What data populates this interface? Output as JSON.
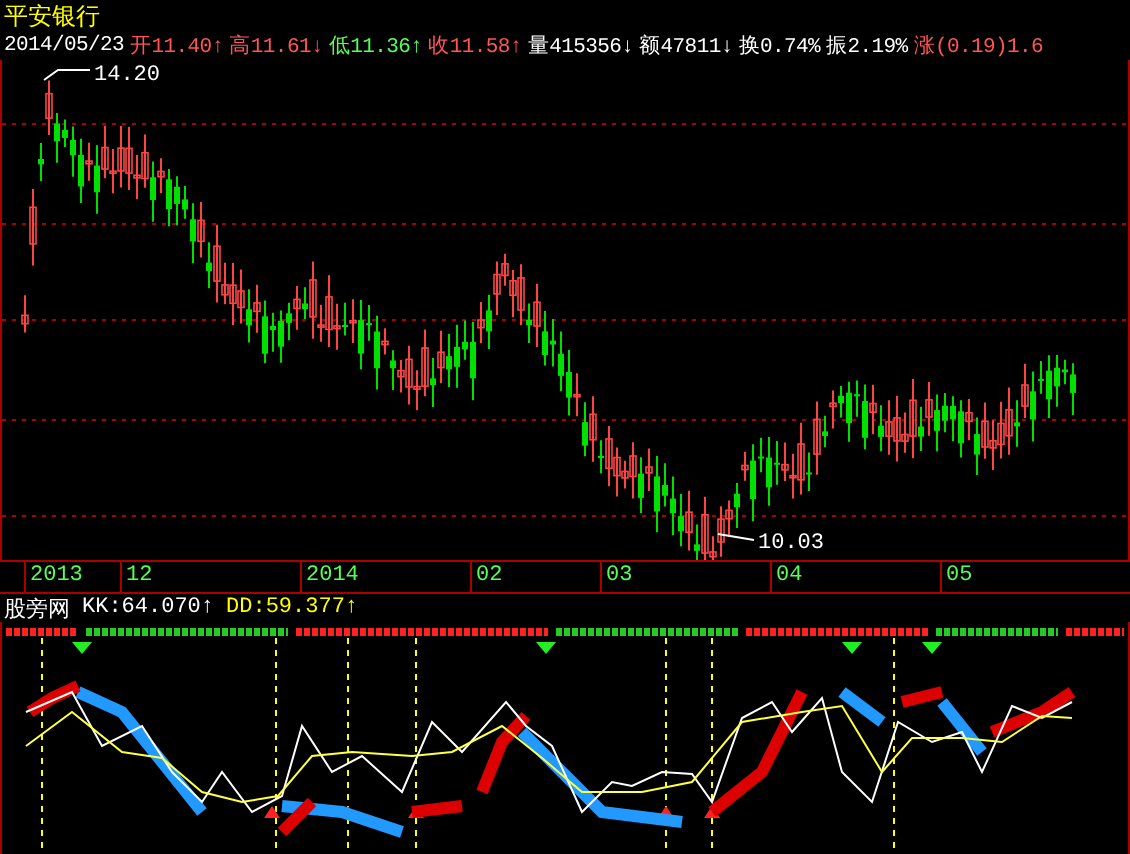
{
  "stock": {
    "name": "平安银行"
  },
  "quote": {
    "date": "2014/05/23",
    "items": [
      {
        "label": "开",
        "value": "11.40",
        "arrow": "↑",
        "color": "#ff5555"
      },
      {
        "label": "高",
        "value": "11.61",
        "arrow": "↓",
        "color": "#ff5555"
      },
      {
        "label": "低",
        "value": "11.36",
        "arrow": "↑",
        "color": "#55ff55"
      },
      {
        "label": "收",
        "value": "11.58",
        "arrow": "↑",
        "color": "#ff5555"
      },
      {
        "label": "量",
        "value": "415356",
        "arrow": "↓",
        "color": "#ffffff"
      },
      {
        "label": "额",
        "value": "47811",
        "arrow": "↓",
        "color": "#ffffff"
      },
      {
        "label": "换",
        "value": "0.74%",
        "color": "#ffffff"
      },
      {
        "label": "振",
        "value": "2.19%",
        "color": "#ffffff"
      },
      {
        "label": "涨",
        "value": "(0.19)1.6",
        "color": "#ff5555"
      }
    ]
  },
  "price_chart": {
    "high_label": "14.20",
    "low_label": "10.03"
  },
  "time_axis": [
    "2013",
    "12",
    "2014",
    "02",
    "03",
    "04",
    "05"
  ],
  "indicator": {
    "name": "股旁网",
    "values": [
      {
        "text": "KK:64.070↑",
        "color": "#ffffff"
      },
      {
        "text": "DD:59.377↑",
        "color": "#ffff00"
      }
    ]
  }
}
